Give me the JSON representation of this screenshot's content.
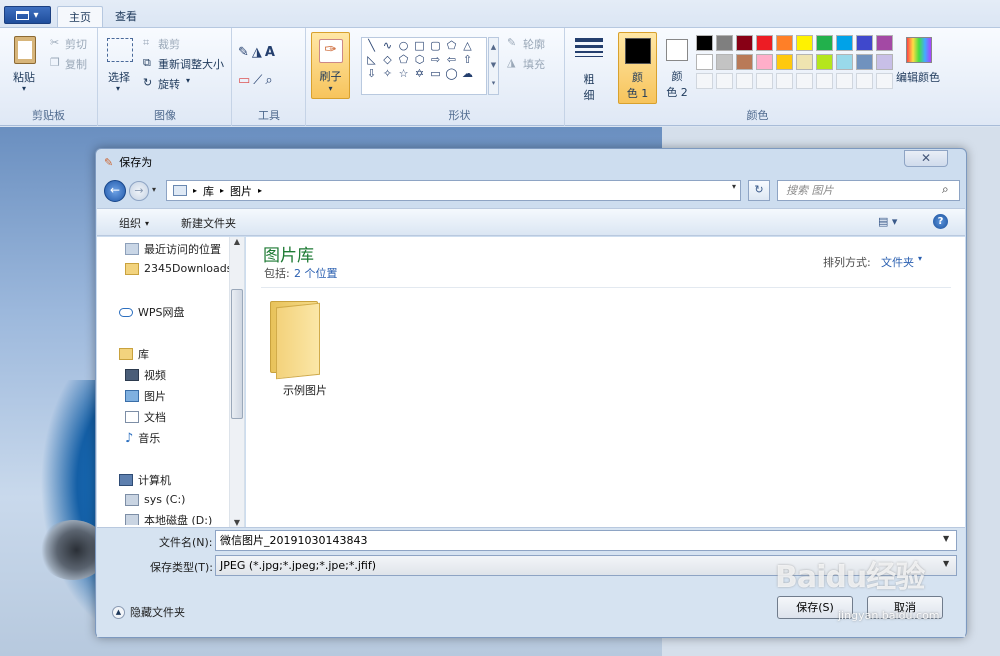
{
  "ribbon": {
    "tabs": [
      "主页",
      "查看"
    ],
    "clipboard": {
      "paste": "粘贴",
      "cut": "剪切",
      "copy": "复制",
      "label": "剪贴板"
    },
    "image": {
      "select": "选择",
      "crop": "裁剪",
      "resize": "重新调整大小",
      "rotate": "旋转",
      "label": "图像"
    },
    "tools": {
      "label": "工具"
    },
    "brush": {
      "label": "刷子"
    },
    "shapes": {
      "outline": "轮廓",
      "fill": "填充",
      "label": "形状"
    },
    "size": {
      "label1": "粗",
      "label2": "细"
    },
    "color1": {
      "label1": "颜",
      "label2": "色 1"
    },
    "color2": {
      "label1": "颜",
      "label2": "色 2"
    },
    "colors": {
      "label": "颜色",
      "edit": "编辑颜色"
    }
  },
  "palette": [
    "#000000",
    "#7f7f7f",
    "#880015",
    "#ed1c24",
    "#ff7f27",
    "#fff200",
    "#22b14c",
    "#00a2e8",
    "#3f48cc",
    "#a349a4",
    "#ffffff",
    "#c3c3c3",
    "#b97a57",
    "#ffaec9",
    "#ffc90e",
    "#efe4b0",
    "#b5e61d",
    "#99d9ea",
    "#7092be",
    "#c8bfe7"
  ],
  "dialog": {
    "title": "保存为",
    "breadcrumb": [
      "库",
      "图片"
    ],
    "search_placeholder": "搜索 图片",
    "toolbar": {
      "organize": "组织",
      "new_folder": "新建文件夹"
    },
    "nav": {
      "recent": "最近访问的位置",
      "downloads": "2345Downloads",
      "wps": "WPS网盘",
      "library": "库",
      "videos": "视频",
      "pictures": "图片",
      "documents": "文档",
      "music": "音乐",
      "computer": "计算机",
      "sys": "sys (C:)",
      "local_d": "本地磁盘 (D:)"
    },
    "library_title": "图片库",
    "library_includes": "包括:",
    "library_locations": "2 个位置",
    "arrange_label": "排列方式:",
    "arrange_value": "文件夹",
    "folder_name": "示例图片",
    "filename_label": "文件名(N):",
    "filename_value": "微信图片_20191030143843",
    "filetype_label": "保存类型(T):",
    "filetype_value": "JPEG (*.jpg;*.jpeg;*.jpe;*.jfif)",
    "hide_folders": "隐藏文件夹",
    "save": "保存(S)",
    "cancel": "取消"
  },
  "watermark": {
    "text": "Baidu经验",
    "url": "jingyan.baidu.com"
  }
}
